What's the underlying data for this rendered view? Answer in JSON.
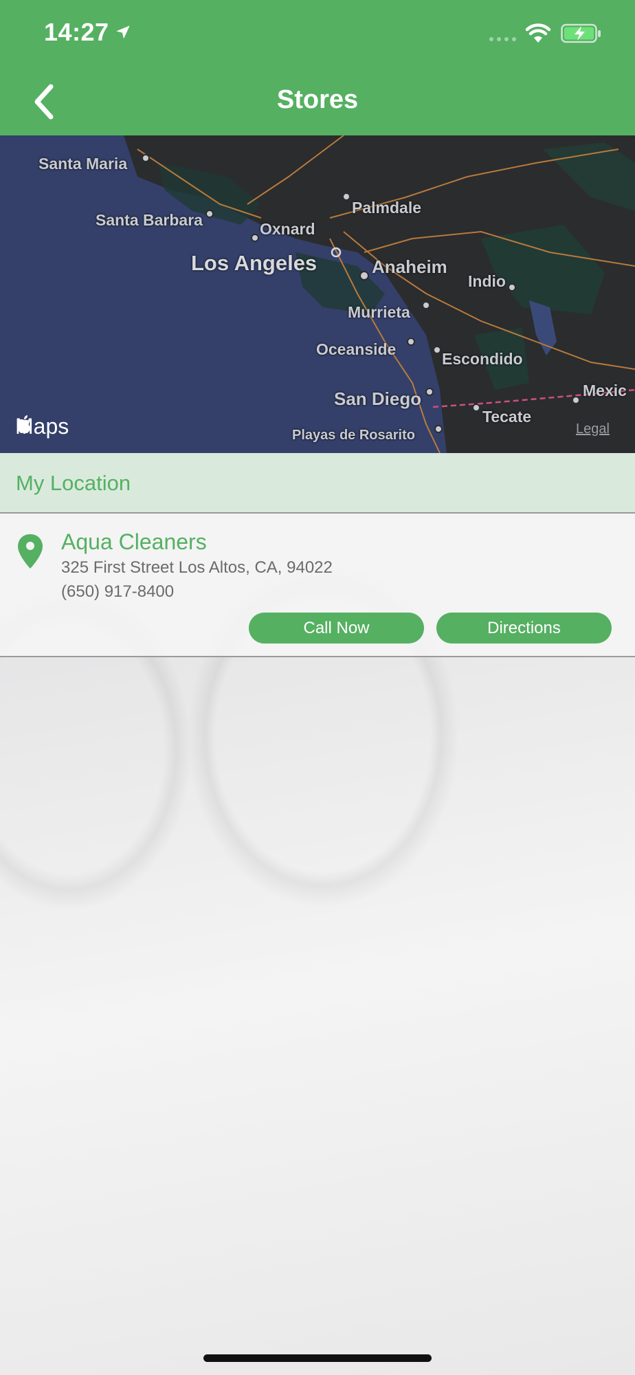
{
  "status_bar": {
    "time": "14:27"
  },
  "nav": {
    "title": "Stores",
    "back_icon": "chevron-left-icon"
  },
  "map": {
    "labels": {
      "santa_maria": "Santa Maria",
      "santa_barbara": "Santa Barbara",
      "palmdale": "Palmdale",
      "oxnard": "Oxnard",
      "los_angeles": "Los Angeles",
      "anaheim": "Anaheim",
      "indio": "Indio",
      "murrieta": "Murrieta",
      "oceanside": "Oceanside",
      "escondido": "Escondido",
      "san_diego": "San Diego",
      "tecate": "Tecate",
      "mexicali": "Mexic",
      "playas": "Playas de Rosarito"
    },
    "attribution": "Maps",
    "legal": "Legal"
  },
  "section": {
    "title": "My Location"
  },
  "store": {
    "name": "Aqua Cleaners",
    "address": "325 First Street Los Altos, CA, 94022",
    "phone": "(650) 917-8400",
    "call_label": "Call Now",
    "directions_label": "Directions"
  },
  "colors": {
    "brand": "#55b062",
    "header_text": "#ffffff",
    "section_bg": "#d6eadb"
  }
}
